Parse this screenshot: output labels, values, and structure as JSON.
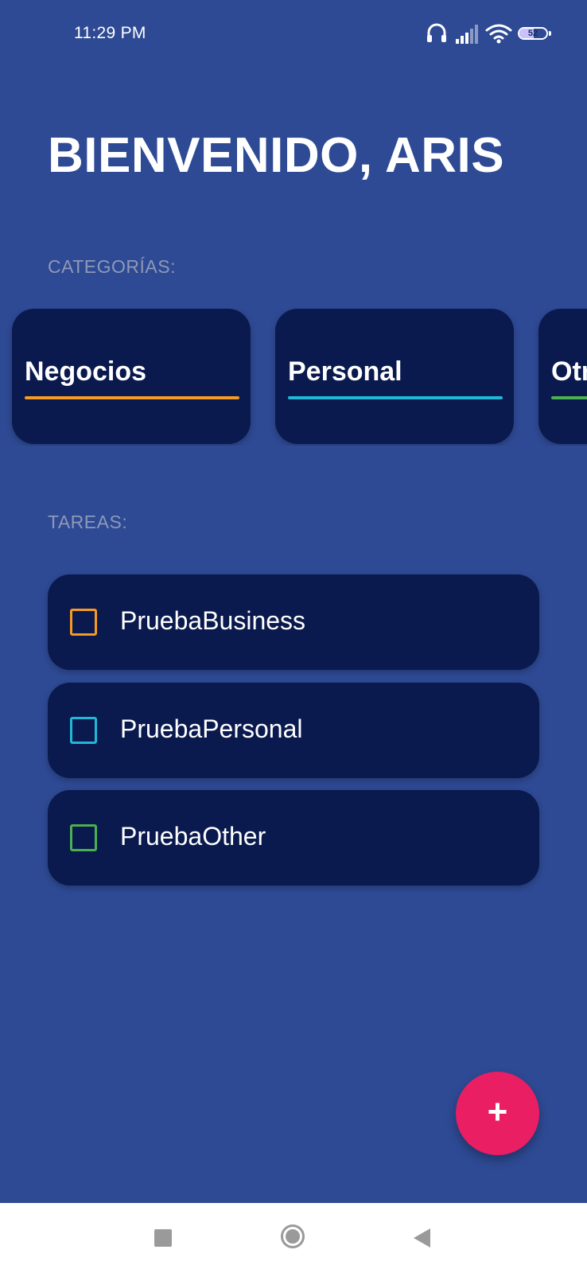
{
  "status_bar": {
    "time": "11:29 PM",
    "battery_level": "52",
    "battery_fraction": 0.52,
    "icons": [
      "headset-icon",
      "signal-icon",
      "wifi-icon",
      "battery-icon"
    ]
  },
  "header": {
    "title": "BIENVENIDO, ARIS"
  },
  "categories": {
    "label": "CATEGORÍAS:",
    "items": [
      {
        "name": "Negocios",
        "color": "#f59a23"
      },
      {
        "name": "Personal",
        "color": "#1fb8d6"
      },
      {
        "name": "Otr",
        "color": "#4caf50"
      }
    ]
  },
  "tasks": {
    "label": "TAREAS:",
    "items": [
      {
        "name": "PruebaBusiness",
        "color": "#f59a23",
        "checked": false
      },
      {
        "name": "PruebaPersonal",
        "color": "#1fb8d6",
        "checked": false
      },
      {
        "name": "PruebaOther",
        "color": "#4caf50",
        "checked": false
      }
    ]
  },
  "fab": {
    "label": "+",
    "color": "#e91e63"
  },
  "nav_bar": {
    "icons": [
      "recent-apps-icon",
      "home-icon",
      "back-icon"
    ]
  },
  "colors": {
    "background": "#2e4a94",
    "card": "#0a1a4e",
    "muted_label": "#8e98b8"
  }
}
